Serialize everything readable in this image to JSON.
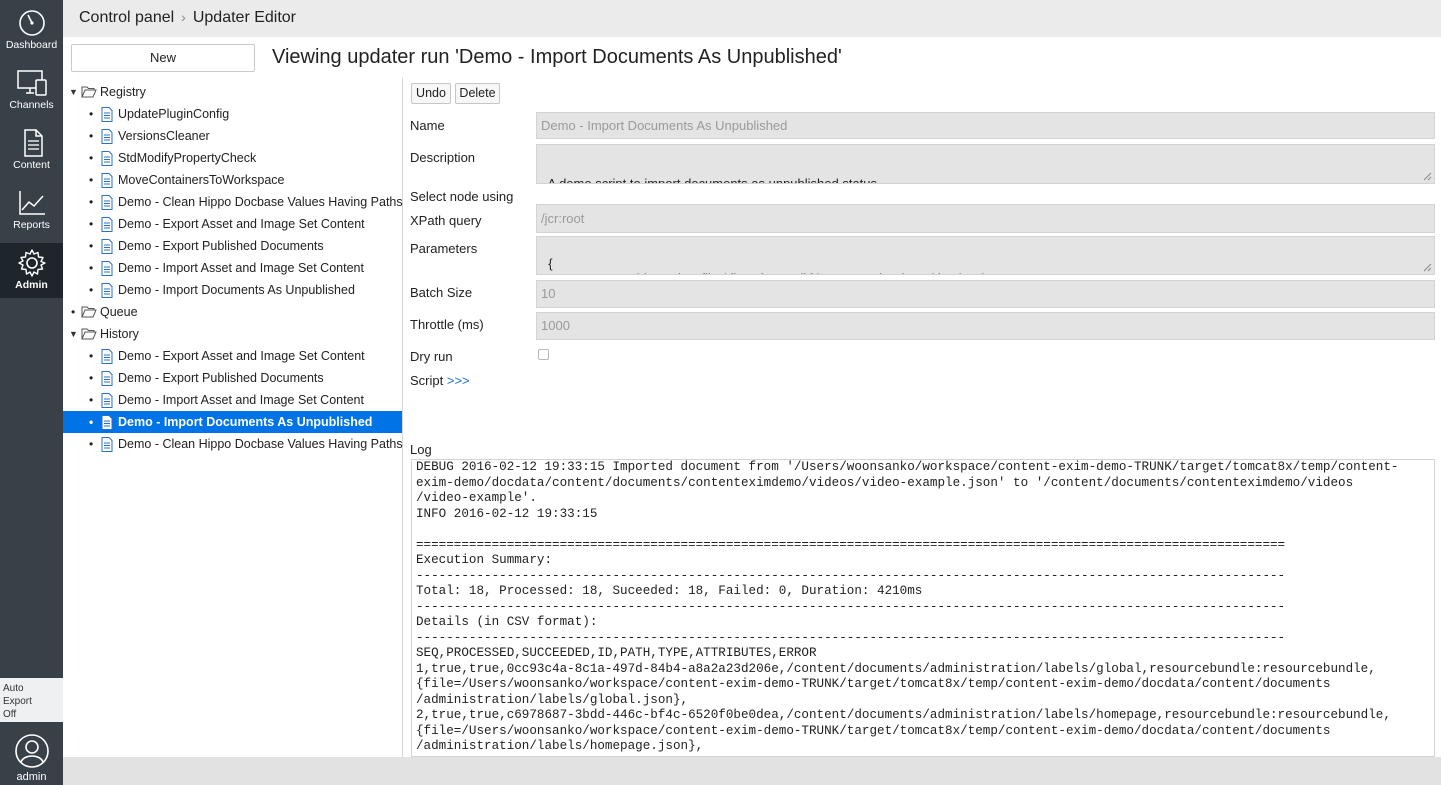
{
  "nav": {
    "items": [
      {
        "label": "Dashboard",
        "icon": "gauge-icon"
      },
      {
        "label": "Channels",
        "icon": "devices-icon"
      },
      {
        "label": "Content",
        "icon": "document-icon"
      },
      {
        "label": "Reports",
        "icon": "chart-icon"
      },
      {
        "label": "Admin",
        "icon": "gear-icon",
        "active": true
      }
    ],
    "auto_export": [
      "Auto",
      "Export",
      "Off"
    ],
    "user": "admin"
  },
  "breadcrumb": {
    "root": "Control panel",
    "current": "Updater Editor"
  },
  "left": {
    "new_label": "New",
    "tree": {
      "registry": {
        "label": "Registry",
        "items": [
          "UpdatePluginConfig",
          "VersionsCleaner",
          "StdModifyPropertyCheck",
          "MoveContainersToWorkspace",
          "Demo - Clean Hippo Docbase Values Having Paths",
          "Demo - Export Asset and Image Set Content",
          "Demo - Export Published Documents",
          "Demo - Import Asset and Image Set Content",
          "Demo - Import Documents As Unpublished"
        ]
      },
      "queue": {
        "label": "Queue"
      },
      "history": {
        "label": "History",
        "items": [
          "Demo - Export Asset and Image Set Content",
          "Demo - Export Published Documents",
          "Demo - Import Asset and Image Set Content",
          "Demo - Import Documents As Unpublished",
          "Demo - Clean Hippo Docbase Values Having Paths"
        ],
        "selected_index": 3
      }
    }
  },
  "main": {
    "title": "Viewing updater run 'Demo - Import Documents As Unpublished'",
    "undo_label": "Undo",
    "delete_label": "Delete",
    "name_label": "Name",
    "name_value": "Demo - Import Documents As Unpublished",
    "description_label": "Description",
    "description_value": "A demo script to import documents as unpublished status.",
    "select_node_label": "Select node using",
    "xpath_label": "XPath query",
    "xpath_value": "/jcr:root",
    "parameters_label": "Parameters",
    "parameters_value": "{\n  \"sourceBaseFolderPath\": \"file:${java.io.tmpdir}/content-exim-demo/docdata/\"",
    "batch_label": "Batch Size",
    "batch_value": "10",
    "throttle_label": "Throttle (ms)",
    "throttle_value": "1000",
    "dryrun_label": "Dry run",
    "dryrun_checked": false,
    "script_label": "Script",
    "script_link": ">>>",
    "log_label": "Log",
    "log_text": "DEBUG 2016-02-12 19:33:15 Imported document from '/Users/woonsanko/workspace/content-exim-demo-TRUNK/target/tomcat8x/temp/content-\nexim-demo/docdata/content/documents/contenteximdemo/videos/video-example.json' to '/content/documents/contenteximdemo/videos\n/video-example'.\nINFO 2016-02-12 19:33:15\n\n===================================================================================================================\nExecution Summary:\n-------------------------------------------------------------------------------------------------------------------\nTotal: 18, Processed: 18, Suceeded: 18, Failed: 0, Duration: 4210ms\n-------------------------------------------------------------------------------------------------------------------\nDetails (in CSV format):\n-------------------------------------------------------------------------------------------------------------------\nSEQ,PROCESSED,SUCCEEDED,ID,PATH,TYPE,ATTRIBUTES,ERROR\n1,true,true,0cc93c4a-8c1a-497d-84b4-a8a2a23d206e,/content/documents/administration/labels/global,resourcebundle:resourcebundle,\n{file=/Users/woonsanko/workspace/content-exim-demo-TRUNK/target/tomcat8x/temp/content-exim-demo/docdata/content/documents\n/administration/labels/global.json},\n2,true,true,c6978687-3bdd-446c-bf4c-6520f0be0dea,/content/documents/administration/labels/homepage,resourcebundle:resourcebundle,\n{file=/Users/woonsanko/workspace/content-exim-demo-TRUNK/target/tomcat8x/temp/content-exim-demo/docdata/content/documents\n/administration/labels/homepage.json},"
  },
  "colors": {
    "nav_bg": "#384048",
    "nav_active_bg": "#1e262c",
    "selection": "#0073e6",
    "link": "#1a73c8"
  }
}
